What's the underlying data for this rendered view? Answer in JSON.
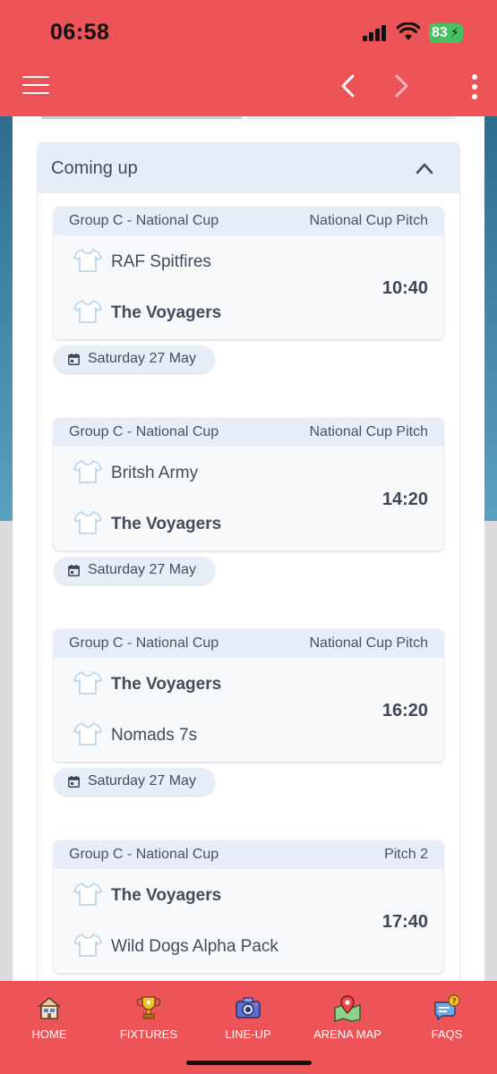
{
  "status_bar": {
    "time": "06:58",
    "battery": "83"
  },
  "section": {
    "title": "Coming up"
  },
  "matches": [
    {
      "competition": "Group C - National Cup",
      "pitch": "National Cup Pitch",
      "home": "RAF Spitfires",
      "away": "The Voyagers",
      "time": "10:40",
      "date": "Saturday 27 May"
    },
    {
      "competition": "Group C - National Cup",
      "pitch": "National Cup Pitch",
      "home": "Britsh Army",
      "away": "The Voyagers",
      "time": "14:20",
      "date": "Saturday 27 May"
    },
    {
      "competition": "Group C - National Cup",
      "pitch": "National Cup Pitch",
      "home": "The Voyagers",
      "away": "Nomads 7s",
      "time": "16:20",
      "date": "Saturday 27 May"
    },
    {
      "competition": "Group C - National Cup",
      "pitch": "Pitch 2",
      "home": "The Voyagers",
      "away": "Wild Dogs Alpha Pack",
      "time": "17:40"
    }
  ],
  "bottom_nav": {
    "items": [
      {
        "label": "HOME",
        "icon": "home-icon"
      },
      {
        "label": "FIXTURES",
        "icon": "trophy-icon"
      },
      {
        "label": "LINE-UP",
        "icon": "camera-icon"
      },
      {
        "label": "ARENA MAP",
        "icon": "map-pin-icon"
      },
      {
        "label": "FAQS",
        "icon": "chat-question-icon"
      }
    ]
  },
  "colors": {
    "header_bg": "#ec5458",
    "card_header_bg": "#e8eef8",
    "shirt_outline": "#bcd6ea"
  }
}
